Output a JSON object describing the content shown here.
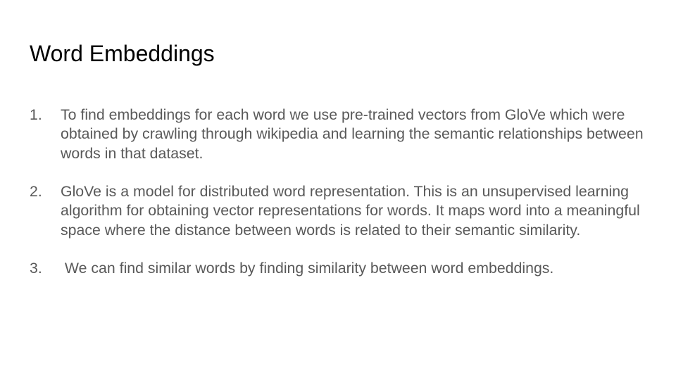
{
  "slide": {
    "title": "Word Embeddings",
    "items": [
      {
        "number": "1.",
        "text": "To find embeddings for each word we use pre-trained vectors from GloVe which were obtained by crawling through wikipedia and learning the semantic relationships between words in that dataset."
      },
      {
        "number": "2.",
        "text": "GloVe is a model for distributed word representation. This is an unsupervised learning algorithm for obtaining vector representations for words. It maps word into a meaningful space where the distance between words is related to their semantic similarity."
      },
      {
        "number": "3.",
        "text": " We can find similar words by finding similarity between word embeddings."
      }
    ]
  }
}
